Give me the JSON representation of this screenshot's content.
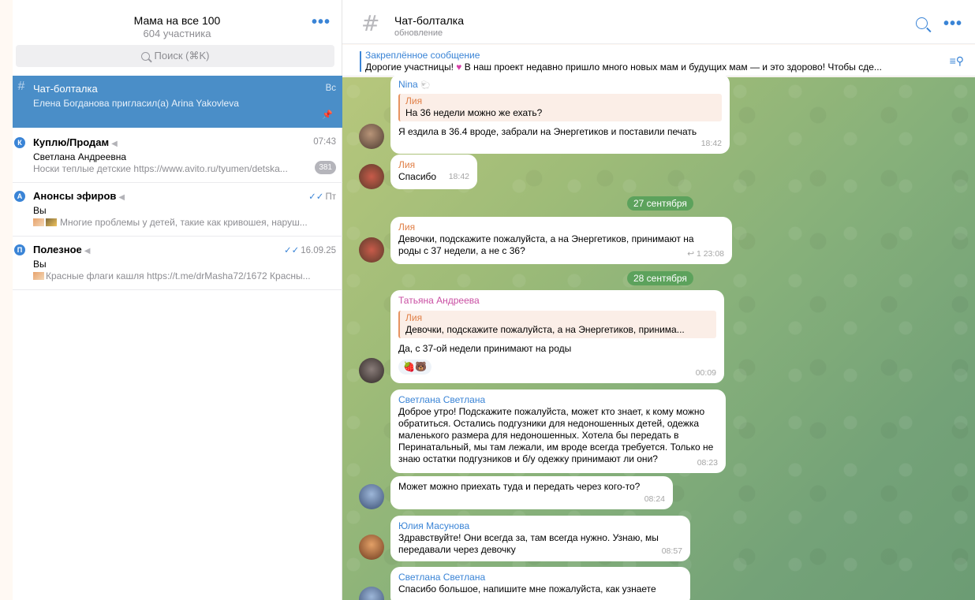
{
  "sidebar": {
    "title": "Мама на все 100",
    "subtitle": "604 участника",
    "more_icon": "•••",
    "search_placeholder": "Поиск (⌘K)",
    "chats": [
      {
        "title": "Чат-болталка",
        "preview": "Елена Богданова пригласил(а) Arina Yakovleva",
        "time": "Вс",
        "pinned": true
      },
      {
        "title": "Куплю/Продам",
        "letter": "К",
        "sender": "Светлана Андреевна",
        "preview": "Носки теплые детские https://www.avito.ru/tyumen/detska...",
        "time": "07:43",
        "badge": "381"
      },
      {
        "title": "Анонсы эфиров",
        "letter": "А",
        "sender": "Вы",
        "preview": "Многие проблемы у детей, такие как кривошея, наруш...",
        "time": "Пт",
        "read": "✓✓"
      },
      {
        "title": "Полезное",
        "letter": "П",
        "sender": "Вы",
        "preview": "Красные флаги кашля https://t.me/drMasha72/1672  Красны...",
        "time": "16.09.25",
        "read": "✓✓"
      }
    ]
  },
  "chat": {
    "title": "Чат-болталка",
    "subtitle": "обновление",
    "pinned_title": "Закреплённое сообщение",
    "pinned_text_a": "Дорогие участницы! ",
    "pinned_heart": "♥",
    "pinned_text_b": "  В наш проект недавно пришло много новых мам и будущих мам — и это здорово!  Чтобы сде...",
    "messages": [
      {
        "name": "Nina",
        "name_suffix": "🐑",
        "name_color": "#3a84d6",
        "quote_name": "Лия",
        "quote_text": "На 36 недели можно же ехать?",
        "text": "Я ездила в 36.4 вроде, забрали на Энергетиков и поставили печать",
        "time": "18:42"
      },
      {
        "name": "Лия",
        "name_color": "#e07f46",
        "text": "Спасибо",
        "time": "18:42"
      },
      {
        "name": "Лия",
        "name_color": "#e07f46",
        "text": "Девочки, подскажите пожалуйста, а на Энергетиков, принимают на роды с 37 недели, а не с 36?",
        "time": "23:08",
        "replies": "↩ 1"
      },
      {
        "name": "Татьяна Андреева",
        "name_color": "#c94fa3",
        "quote_name": "Лия",
        "quote_text": "Девочки, подскажите пожалуйста, а на Энергетиков, принима...",
        "text": "Да, с 37-ой недели принимают на роды",
        "time": "00:09",
        "reactions": [
          "🍓",
          "🐻"
        ]
      },
      {
        "name": "Светлана Светлана",
        "name_color": "#3a84d6",
        "text": "Доброе утро! Подскажите пожалуйста, может кто знает, к кому можно обратиться. Остались подгузники для недоношенных детей, одежка маленького размера для недоношенных. Хотела бы передать в Перинатальный, мы там лежали, им вроде всегда требуется. Только не знаю остатки подгузников и б/у одежку принимают ли они?",
        "time": "08:23"
      },
      {
        "text": "Может можно приехать туда и передать через кого-то?",
        "time": "08:24"
      },
      {
        "name": "Юлия Масунова",
        "name_color": "#3a84d6",
        "text": "Здравствуйте! Они всегда за, там всегда нужно. Узнаю, мы передавали через девочку",
        "time": "08:57"
      },
      {
        "name": "Светлана Светлана",
        "name_color": "#3a84d6",
        "text": "Спасибо большое, напишите мне пожалуйста, как узнаете"
      }
    ],
    "dates": [
      "27 сентября",
      "28 сентября"
    ]
  },
  "colors": {
    "accent": "#3a84d6",
    "active_chat": "#4a8ec8",
    "date_pill": "#5ca25c"
  }
}
